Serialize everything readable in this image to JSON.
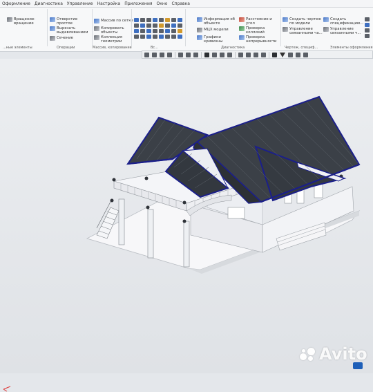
{
  "menu": [
    "Оформление",
    "Диагностика",
    "Управление",
    "Настройка",
    "Приложения",
    "Окно",
    "Справка"
  ],
  "ribbon": {
    "items": [
      {
        "label": "Вращение-\nвращение",
        "icon": "revolve-icon"
      },
      {
        "label": "Отверстие\nпростое",
        "icon": "hole-icon"
      },
      {
        "label": "Вырезать\nвыдавливанием",
        "icon": "cut-extrude-icon"
      },
      {
        "label": "Сечение",
        "icon": "section-icon"
      },
      {
        "label": "Массив по сетке",
        "icon": "grid-array-icon"
      },
      {
        "label": "Копировать\nобъекты",
        "icon": "copy-objects-icon"
      },
      {
        "label": "Коллекция\nгеометрии",
        "icon": "geometry-collection-icon"
      },
      {
        "label": "Информация об\nобъекте",
        "icon": "object-info-icon"
      },
      {
        "label": "МЦХ модели",
        "icon": "mass-properties-icon"
      },
      {
        "label": "Графики\nкривизны",
        "icon": "curvature-graph-icon"
      },
      {
        "label": "Расстояние и\nугол",
        "icon": "distance-angle-icon"
      },
      {
        "label": "Проверка\nколлизий",
        "icon": "collision-check-icon"
      },
      {
        "label": "Проверка\nнепрерывности",
        "icon": "continuity-check-icon"
      },
      {
        "label": "Создать чертеж\nпо модели",
        "icon": "create-drawing-icon"
      },
      {
        "label": "Управление\nсвязанными ча...",
        "icon": "linked-parts-icon"
      },
      {
        "label": "Создать\nспецификацию...",
        "icon": "create-spec-icon"
      },
      {
        "label": "Управление\nсвязанными ч...",
        "icon": "linked-parts-2-icon"
      }
    ],
    "groups": [
      "...ные элементы",
      "Операции",
      "Массив, копирование",
      "Вс...",
      "Диагностика",
      "Чертеж, специф...",
      "Элементы оформления"
    ]
  },
  "viewport": {
    "model": "3D house model",
    "colors": {
      "roof": "#3a3f45",
      "roof_edge": "#1a1e8c",
      "wall": "#f3f3f6",
      "floor": "#f7f7f9"
    }
  },
  "watermark": {
    "text": "Avito"
  }
}
